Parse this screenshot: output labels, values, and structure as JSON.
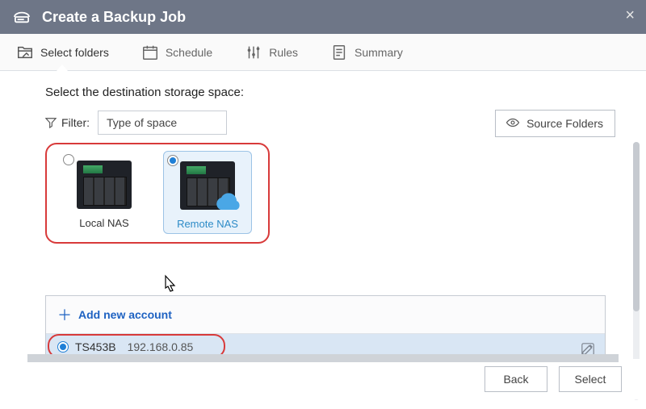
{
  "titlebar": {
    "title": "Create a Backup Job"
  },
  "tabs": {
    "select_folders": "Select folders",
    "schedule": "Schedule",
    "rules": "Rules",
    "summary": "Summary"
  },
  "main": {
    "section_title": "Select the destination storage space:",
    "filter_label": "Filter:",
    "filter_value": "Type of space",
    "source_folders_btn": "Source Folders"
  },
  "space_options": {
    "local_nas": "Local NAS",
    "remote_nas": "Remote NAS"
  },
  "accounts": {
    "add_label": "Add new account",
    "selected": {
      "name": "TS453B",
      "ip": "192.168.0.85"
    }
  },
  "footer": {
    "back": "Back",
    "select": "Select"
  }
}
